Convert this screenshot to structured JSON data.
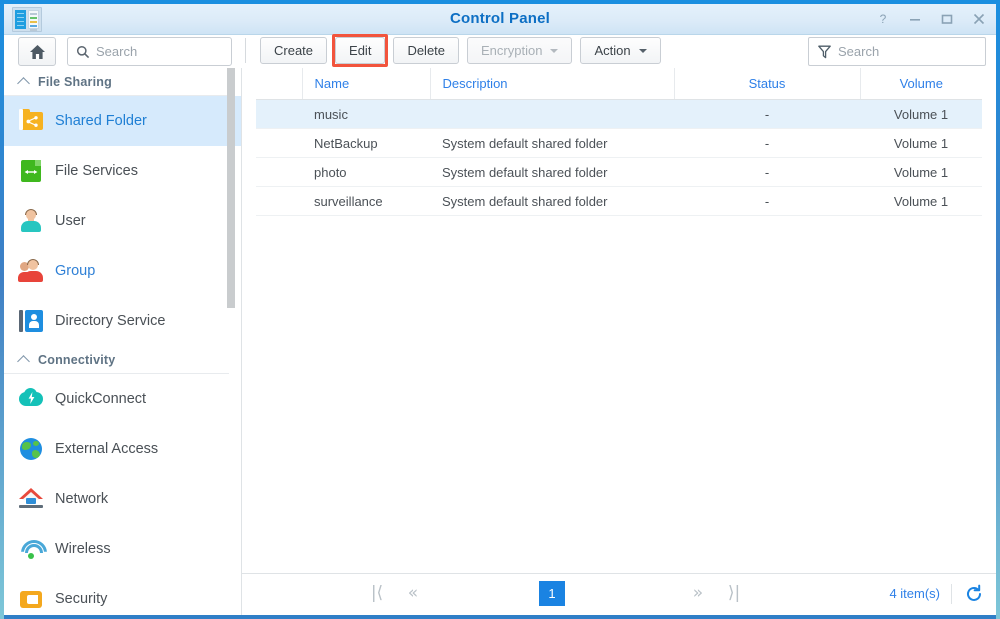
{
  "window": {
    "title": "Control Panel",
    "app_icon": "control-panel-icon",
    "controls": [
      {
        "name": "help-button",
        "glyph": "?"
      },
      {
        "name": "minimize-button",
        "glyph": "–"
      },
      {
        "name": "maximize-button",
        "glyph": "□"
      },
      {
        "name": "close-button",
        "glyph": "✕"
      }
    ]
  },
  "toolbar": {
    "home_icon": "home-icon",
    "search_icon": "search-icon",
    "search_placeholder": "Search",
    "search_value": "",
    "buttons": [
      {
        "label": "Create",
        "name": "create-button",
        "disabled": false,
        "caret": false
      },
      {
        "label": "Edit",
        "name": "edit-button",
        "disabled": false,
        "caret": false,
        "highlighted": true
      },
      {
        "label": "Delete",
        "name": "delete-button",
        "disabled": false,
        "caret": false
      },
      {
        "label": "Encryption",
        "name": "encryption-button",
        "disabled": true,
        "caret": true
      },
      {
        "label": "Action",
        "name": "action-button",
        "disabled": false,
        "caret": true
      }
    ],
    "highlight_color": "#f2543d",
    "filter_icon": "filter-icon",
    "filter_placeholder": "Search",
    "filter_value": ""
  },
  "sidebar": {
    "sections": [
      {
        "label": "File Sharing",
        "name": "sidebar-section-file-sharing",
        "collapsed": false,
        "items": [
          {
            "label": "Shared Folder",
            "name": "sidebar-item-shared-folder",
            "icon": "shared-folder-icon",
            "selected": true,
            "linked": false
          },
          {
            "label": "File Services",
            "name": "sidebar-item-file-services",
            "icon": "file-services-icon",
            "selected": false,
            "linked": false
          },
          {
            "label": "User",
            "name": "sidebar-item-user",
            "icon": "user-icon",
            "selected": false,
            "linked": false
          },
          {
            "label": "Group",
            "name": "sidebar-item-group",
            "icon": "group-icon",
            "selected": false,
            "linked": true
          },
          {
            "label": "Directory Service",
            "name": "sidebar-item-directory-service",
            "icon": "directory-service-icon",
            "selected": false,
            "linked": false
          }
        ]
      },
      {
        "label": "Connectivity",
        "name": "sidebar-section-connectivity",
        "collapsed": false,
        "items": [
          {
            "label": "QuickConnect",
            "name": "sidebar-item-quickconnect",
            "icon": "quickconnect-icon",
            "selected": false,
            "linked": false
          },
          {
            "label": "External Access",
            "name": "sidebar-item-external-access",
            "icon": "external-access-icon",
            "selected": false,
            "linked": false
          },
          {
            "label": "Network",
            "name": "sidebar-item-network",
            "icon": "network-icon",
            "selected": false,
            "linked": false
          },
          {
            "label": "Wireless",
            "name": "sidebar-item-wireless",
            "icon": "wireless-icon",
            "selected": false,
            "linked": false
          },
          {
            "label": "Security",
            "name": "sidebar-item-security",
            "icon": "security-icon",
            "selected": false,
            "linked": false
          }
        ]
      }
    ]
  },
  "table": {
    "columns": [
      {
        "label": "",
        "name": "column-select",
        "align": "left"
      },
      {
        "label": "Name",
        "name": "column-name",
        "align": "left"
      },
      {
        "label": "Description",
        "name": "column-description",
        "align": "left"
      },
      {
        "label": "Status",
        "name": "column-status",
        "align": "center"
      },
      {
        "label": "Volume",
        "name": "column-volume",
        "align": "center"
      }
    ],
    "rows": [
      {
        "name": "music",
        "description": "",
        "status": "-",
        "volume": "Volume 1",
        "selected": true
      },
      {
        "name": "NetBackup",
        "description": "System default shared folder",
        "status": "-",
        "volume": "Volume 1",
        "selected": false
      },
      {
        "name": "photo",
        "description": "System default shared folder",
        "status": "-",
        "volume": "Volume 1",
        "selected": false
      },
      {
        "name": "surveillance",
        "description": "System default shared folder",
        "status": "-",
        "volume": "Volume 1",
        "selected": false
      }
    ]
  },
  "footer": {
    "first_glyph": "|⟨",
    "prev_glyph": "«",
    "next_glyph": "»",
    "last_glyph": "⟩|",
    "current_page": "1",
    "item_count": "4 item(s)",
    "refresh_icon": "refresh-icon"
  },
  "colors": {
    "accent": "#1a83e2",
    "link": "#2f80e8",
    "selection": "#d6eafc",
    "row_selection": "#e4f1fb",
    "highlight": "#f2543d"
  }
}
